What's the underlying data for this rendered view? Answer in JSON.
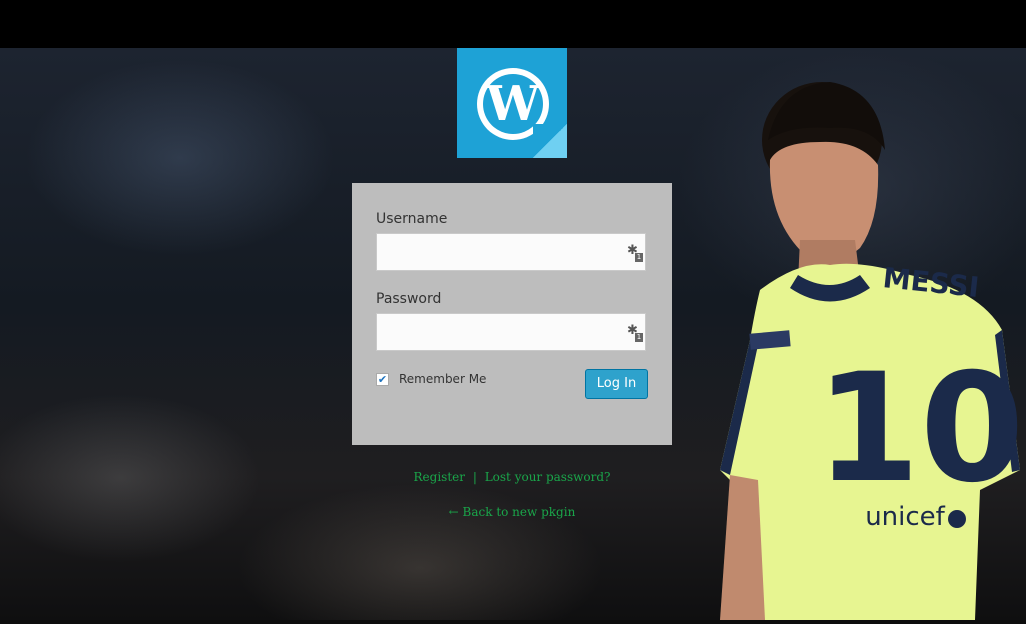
{
  "logo": {
    "icon": "wordpress-logo",
    "glyph": "W",
    "color": "#1ea2d6"
  },
  "form": {
    "username_label": "Username",
    "username_value": "",
    "password_label": "Password",
    "password_value": "",
    "remember_label": "Remember Me",
    "remember_checked": true,
    "check_glyph": "✔",
    "login_button": "Log In",
    "key_icon_glyph": "✱",
    "key_icon_badge": "1"
  },
  "links": {
    "register": "Register",
    "separator": "|",
    "lost_password": "Lost your password?",
    "back": "← Back to new pkgin"
  },
  "jersey": {
    "name": "MESSI",
    "number": "10",
    "sponsor": "unicef"
  },
  "colors": {
    "link": "#1aa64a",
    "button": "#2ea2cc",
    "form_bg": "#bdbdbd"
  }
}
